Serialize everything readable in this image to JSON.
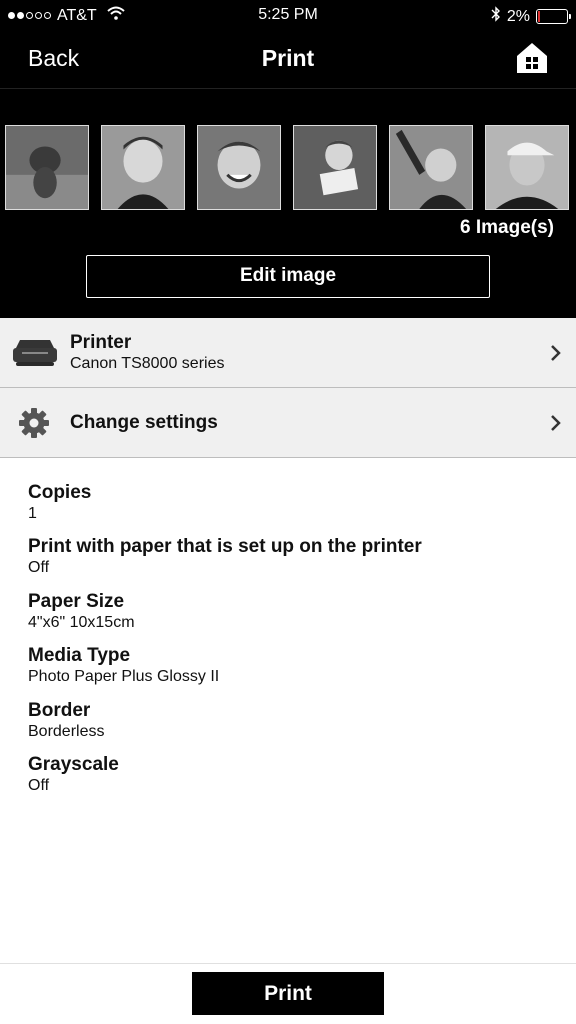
{
  "status_bar": {
    "carrier": "AT&T",
    "time": "5:25 PM",
    "battery": "2%",
    "battery_level": 0.02,
    "signal_dots_filled": 2,
    "signal_dots_total": 5
  },
  "nav": {
    "back_label": "Back",
    "title": "Print",
    "home_icon": "home-icon"
  },
  "images": {
    "thumbnails": [
      "dog",
      "boy-smiling",
      "boy-grinning",
      "toddler-with-paper",
      "child-reaching",
      "man-with-cap"
    ],
    "count_label": "6 Image(s)",
    "edit_label": "Edit image"
  },
  "printer_row": {
    "title": "Printer",
    "subtitle": "Canon TS8000 series",
    "icon": "printer-icon"
  },
  "settings_row": {
    "title": "Change settings",
    "icon": "gear-icon"
  },
  "settings": [
    {
      "label": "Copies",
      "value": "1"
    },
    {
      "label": "Print with paper that is set up on the printer",
      "value": "Off"
    },
    {
      "label": "Paper Size",
      "value": "4\"x6\" 10x15cm"
    },
    {
      "label": "Media Type",
      "value": "Photo Paper Plus Glossy II"
    },
    {
      "label": "Border",
      "value": "Borderless"
    },
    {
      "label": "Grayscale",
      "value": "Off"
    }
  ],
  "footer": {
    "print_label": "Print"
  },
  "colors": {
    "background_dark": "#000000",
    "row_background": "#f0f0f0",
    "battery_low": "#dd3333"
  }
}
